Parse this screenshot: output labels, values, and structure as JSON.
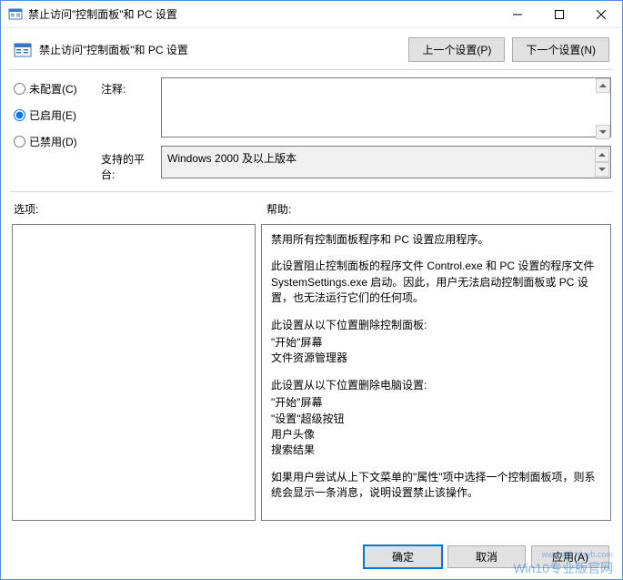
{
  "window": {
    "title": "禁止访问\"控制面板\"和 PC 设置"
  },
  "header": {
    "policy_name": "禁止访问\"控制面板\"和 PC 设置",
    "prev_btn": "上一个设置(P)",
    "next_btn": "下一个设置(N)"
  },
  "config": {
    "radio_not_configured": "未配置(C)",
    "radio_enabled": "已启用(E)",
    "radio_disabled": "已禁用(D)",
    "selected": "enabled",
    "comment_label": "注释:",
    "comment_value": "",
    "platform_label": "支持的平台:",
    "platform_value": "Windows 2000 及以上版本"
  },
  "mid": {
    "options_label": "选项:",
    "help_label": "帮助:"
  },
  "help": {
    "p1": "禁用所有控制面板程序和 PC 设置应用程序。",
    "p2": "此设置阻止控制面板的程序文件 Control.exe 和 PC 设置的程序文件 SystemSettings.exe 启动。因此，用户无法启动控制面板或 PC 设置，也无法运行它们的任何项。",
    "p3": "此设置从以下位置删除控制面板:",
    "p3a": "\"开始\"屏幕",
    "p3b": "文件资源管理器",
    "p4": "此设置从以下位置删除电脑设置:",
    "p4a": "\"开始\"屏幕",
    "p4b": "\"设置\"超级按钮",
    "p4c": "用户头像",
    "p4d": "搜索结果",
    "p5": "如果用户尝试从上下文菜单的\"属性\"项中选择一个控制面板项，则系统会显示一条消息，说明设置禁止该操作。"
  },
  "footer": {
    "ok": "确定",
    "cancel": "取消",
    "apply": "应用(A)"
  },
  "watermark": {
    "url": "www.win10zyb.com",
    "text": "Win10专业版官网"
  }
}
